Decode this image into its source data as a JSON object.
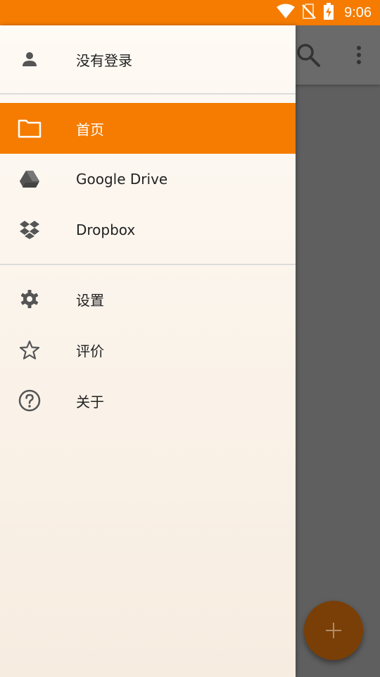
{
  "status_bar": {
    "time": "9:06",
    "icons": [
      "wifi-icon",
      "no-sim-icon",
      "battery-charging-icon"
    ]
  },
  "toolbar": {
    "icons": [
      "search-icon",
      "more-vert-icon"
    ]
  },
  "fab": {
    "label": "+",
    "icon": "add-icon"
  },
  "drawer": {
    "account": {
      "label": "没有登录",
      "icon": "person-icon"
    },
    "storage_items": [
      {
        "label": "首页",
        "icon": "folder-icon",
        "active": true
      },
      {
        "label": "Google Drive",
        "icon": "google-drive-icon",
        "active": false
      },
      {
        "label": "Dropbox",
        "icon": "dropbox-icon",
        "active": false
      }
    ],
    "app_items": [
      {
        "label": "设置",
        "icon": "settings-icon"
      },
      {
        "label": "评价",
        "icon": "star-icon"
      },
      {
        "label": "关于",
        "icon": "help-icon"
      }
    ]
  },
  "colors": {
    "accent": "#f57c00",
    "scrim": "#5f5f5f",
    "drawer_bg": "#fdf7ef",
    "icon": "#5a5a5a",
    "fab_dimmed": "#7a3f06"
  }
}
